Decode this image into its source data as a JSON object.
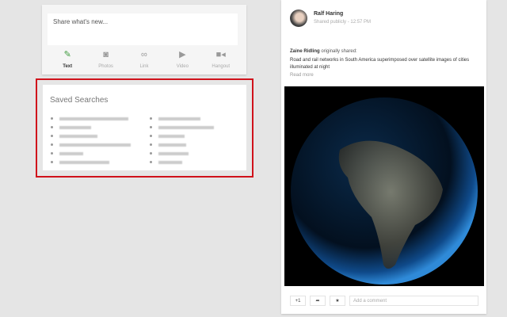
{
  "share": {
    "placeholder": "Share what's new...",
    "actions": [
      {
        "label": "Text",
        "icon": "pencil-icon"
      },
      {
        "label": "Photos",
        "icon": "camera-icon"
      },
      {
        "label": "Link",
        "icon": "link-icon"
      },
      {
        "label": "Video",
        "icon": "video-icon"
      },
      {
        "label": "Hangout",
        "icon": "hangout-camera-icon"
      }
    ]
  },
  "saved": {
    "title": "Saved Searches"
  },
  "post": {
    "author": "Ralf Haring",
    "visibility": "Shared publicly",
    "time": "12:57 PM",
    "separator": "-",
    "original_author": "Zaine Ridling",
    "original_suffix": " originally shared:",
    "description": "Road and rail networks in South America superimposed over satellite images of cities illuminated at night",
    "read_more": "Read more",
    "plus_one": "+1",
    "share_icon": "share-icon",
    "star_icon": "star-icon",
    "comment_placeholder": "Add a comment"
  },
  "colors": {
    "highlight": "#d0121b",
    "active": "#3c9a3c"
  }
}
